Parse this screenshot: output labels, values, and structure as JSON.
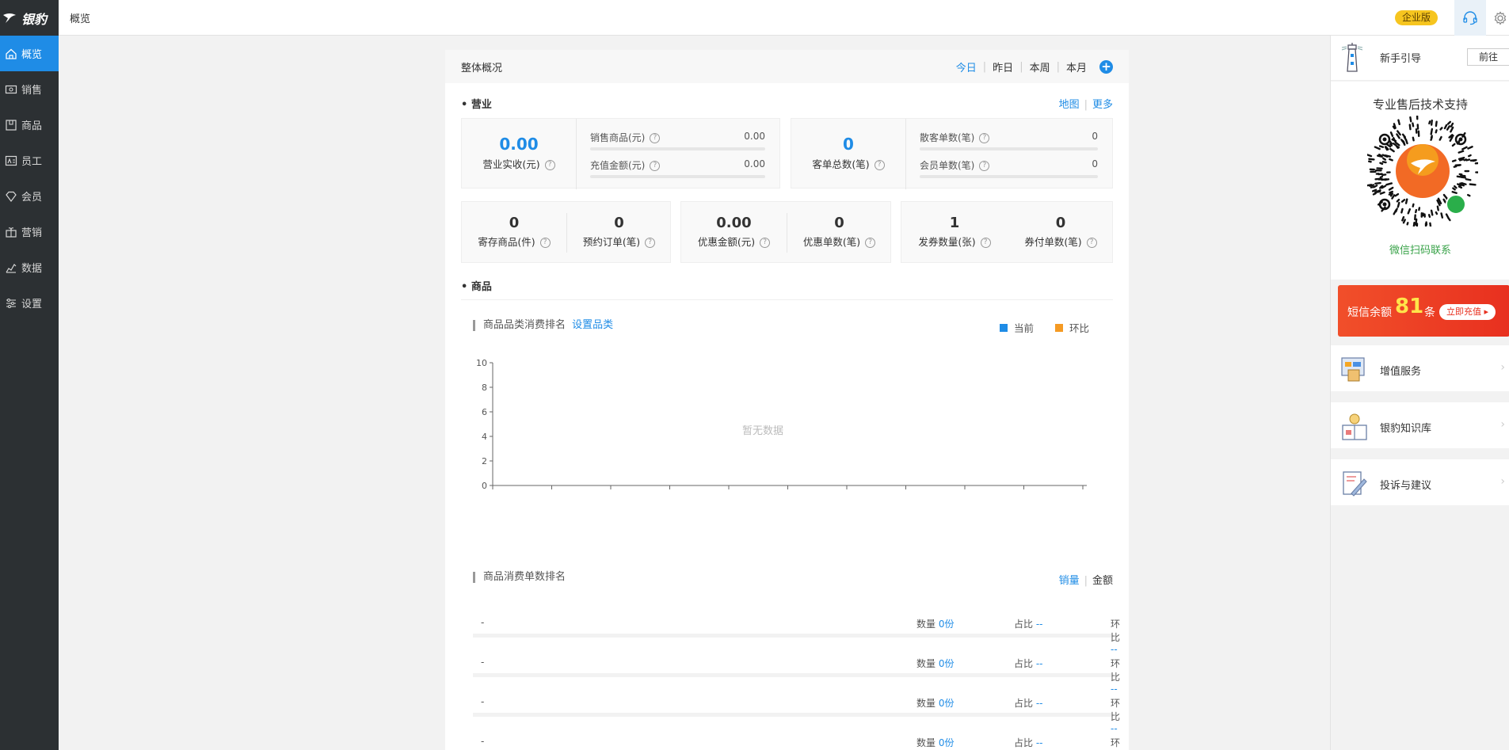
{
  "app": {
    "brand": "银豹",
    "page_title": "概览"
  },
  "sidebar": {
    "items": [
      {
        "label": "概览",
        "icon": "home-icon",
        "active": true
      },
      {
        "label": "销售",
        "icon": "cash-icon"
      },
      {
        "label": "商品",
        "icon": "box-icon"
      },
      {
        "label": "员工",
        "icon": "id-card-icon"
      },
      {
        "label": "会员",
        "icon": "diamond-icon"
      },
      {
        "label": "营销",
        "icon": "gift-icon"
      },
      {
        "label": "数据",
        "icon": "chart-icon"
      },
      {
        "label": "设置",
        "icon": "sliders-icon"
      }
    ]
  },
  "topbar": {
    "edition_badge": "企业版",
    "support_icon": "headset-icon",
    "settings_icon": "gear-icon"
  },
  "overview": {
    "title": "整体概况",
    "ranges": [
      "今日",
      "昨日",
      "本周",
      "本月"
    ],
    "active_range": "今日",
    "add_icon": "plus-icon"
  },
  "business": {
    "title": "营业",
    "links": [
      "地图",
      "更多"
    ],
    "actual_income": {
      "value": "0.00",
      "label": "营业实收(元)"
    },
    "sales_goods": {
      "label": "销售商品(元)",
      "value": "0.00"
    },
    "recharge_amount": {
      "label": "充值金额(元)",
      "value": "0.00"
    },
    "total_orders": {
      "value": "0",
      "label": "客单总数(笔)"
    },
    "walkin_orders": {
      "label": "散客单数(笔)",
      "value": "0"
    },
    "member_orders": {
      "label": "会员单数(笔)",
      "value": "0"
    }
  },
  "stats_row": [
    {
      "value": "0",
      "label": "寄存商品(件)"
    },
    {
      "value": "0",
      "label": "预约订单(笔)"
    },
    {
      "value": "0.00",
      "label": "优惠金额(元)"
    },
    {
      "value": "0",
      "label": "优惠单数(笔)"
    },
    {
      "value": "1",
      "label": "发券数量(张)"
    },
    {
      "value": "0",
      "label": "券付单数(笔)"
    }
  ],
  "goods": {
    "title": "商品",
    "category_rank": {
      "title": "商品品类消费排名",
      "set_link": "设置品类",
      "legend_current": "当前",
      "legend_compare": "环比",
      "color_current": "#1f8ce6",
      "color_compare": "#f59a23",
      "empty_text": "暂无数据"
    },
    "order_rank": {
      "title": "商品消费单数排名",
      "tab_volume": "销量",
      "tab_amount": "金额",
      "rows": [
        {
          "name": "-",
          "qty_label": "数量",
          "qty": "0份",
          "pct_label": "占比",
          "pct": "--",
          "cmp_label": "环比",
          "cmp": "--"
        },
        {
          "name": "-",
          "qty_label": "数量",
          "qty": "0份",
          "pct_label": "占比",
          "pct": "--",
          "cmp_label": "环比",
          "cmp": "--"
        },
        {
          "name": "-",
          "qty_label": "数量",
          "qty": "0份",
          "pct_label": "占比",
          "pct": "--",
          "cmp_label": "环比",
          "cmp": "--"
        },
        {
          "name": "-",
          "qty_label": "数量",
          "qty": "0份",
          "pct_label": "占比",
          "pct": "--",
          "cmp_label": "环比",
          "cmp": "--"
        }
      ]
    }
  },
  "chart_data": {
    "type": "bar",
    "categories": [],
    "series": [],
    "ylim": [
      0,
      10
    ],
    "yticks": [
      "0",
      "2",
      "4",
      "6",
      "8",
      "10"
    ]
  },
  "right_panel": {
    "guide": {
      "label": "新手引导",
      "button": "前往"
    },
    "support": {
      "title": "专业售后技术支持",
      "wechat": "微信扫码联系"
    },
    "sms": {
      "prefix": "短信余额",
      "count": "81",
      "suffix": "条",
      "button": "立即充值"
    },
    "services": [
      {
        "label": "增值服务",
        "icon": "puzzle-icon"
      },
      {
        "label": "银豹知识库",
        "icon": "book-icon"
      },
      {
        "label": "投诉与建议",
        "icon": "pen-icon"
      }
    ]
  }
}
